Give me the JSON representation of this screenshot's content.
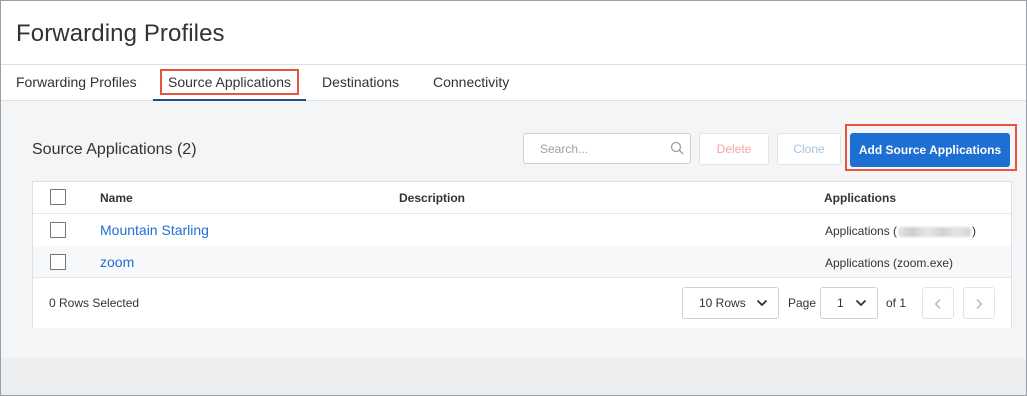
{
  "header": {
    "title": "Forwarding Profiles"
  },
  "tabs": [
    {
      "label": "Forwarding Profiles"
    },
    {
      "label": "Source Applications",
      "active": true
    },
    {
      "label": "Destinations"
    },
    {
      "label": "Connectivity"
    }
  ],
  "section": {
    "title": "Source Applications (2)"
  },
  "toolbar": {
    "search_placeholder": "Search...",
    "delete_label": "Delete",
    "clone_label": "Clone",
    "add_label": "Add Source Applications"
  },
  "table": {
    "columns": {
      "name": "Name",
      "description": "Description",
      "applications": "Applications"
    },
    "rows": [
      {
        "name": "Mountain Starling",
        "description": "",
        "applications_prefix": "Applications (",
        "applications_suffix": ")"
      },
      {
        "name": "zoom",
        "description": "",
        "applications": "Applications (zoom.exe)"
      }
    ]
  },
  "footer": {
    "rows_selected": "0 Rows Selected",
    "rows_per_page": "10 Rows",
    "page_label": "Page",
    "page_value": "1",
    "of_label": "of 1"
  },
  "colors": {
    "accent": "#1e6fd3",
    "highlight_outline": "#e8553e",
    "active_tab_underline": "#1f4f87"
  },
  "icons": [
    "search-icon",
    "chevron-down-icon",
    "chevron-left-icon",
    "chevron-right-icon"
  ]
}
